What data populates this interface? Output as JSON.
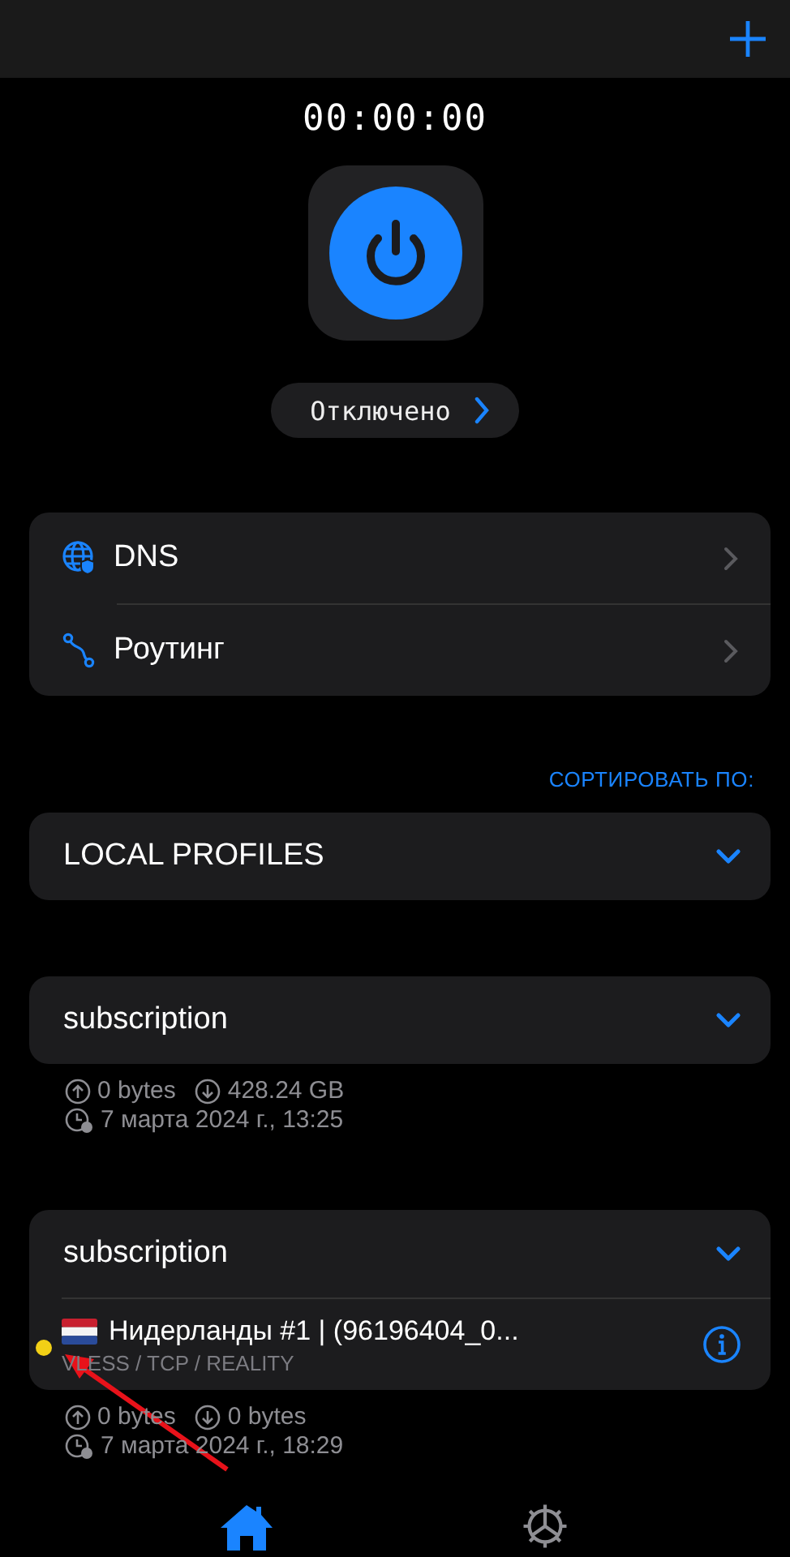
{
  "timer": "00:00:00",
  "status": "Отключено",
  "settings_items": [
    {
      "kind": "dns",
      "label": "DNS"
    },
    {
      "kind": "routing",
      "label": "Роутинг"
    }
  ],
  "sort_label": "СОРТИРОВАТЬ ПО:",
  "groups": [
    {
      "title": "LOCAL PROFILES"
    },
    {
      "title": "subscription",
      "upload": "0 bytes",
      "download": "428.24 GB",
      "updated": "7 марта 2024 г., 13:25"
    },
    {
      "title": "subscription",
      "servers": [
        {
          "name": "Нидерланды #1 | (96196404_0...",
          "protocol": "VLESS / TCP / REALITY",
          "color": "#f2d016"
        }
      ],
      "upload": "0 bytes",
      "download": "0 bytes",
      "updated": "7 марта 2024 г., 18:29"
    }
  ],
  "tab_bar": [
    {
      "kind": "home",
      "selected": true
    },
    {
      "kind": "settings",
      "selected": false
    }
  ]
}
